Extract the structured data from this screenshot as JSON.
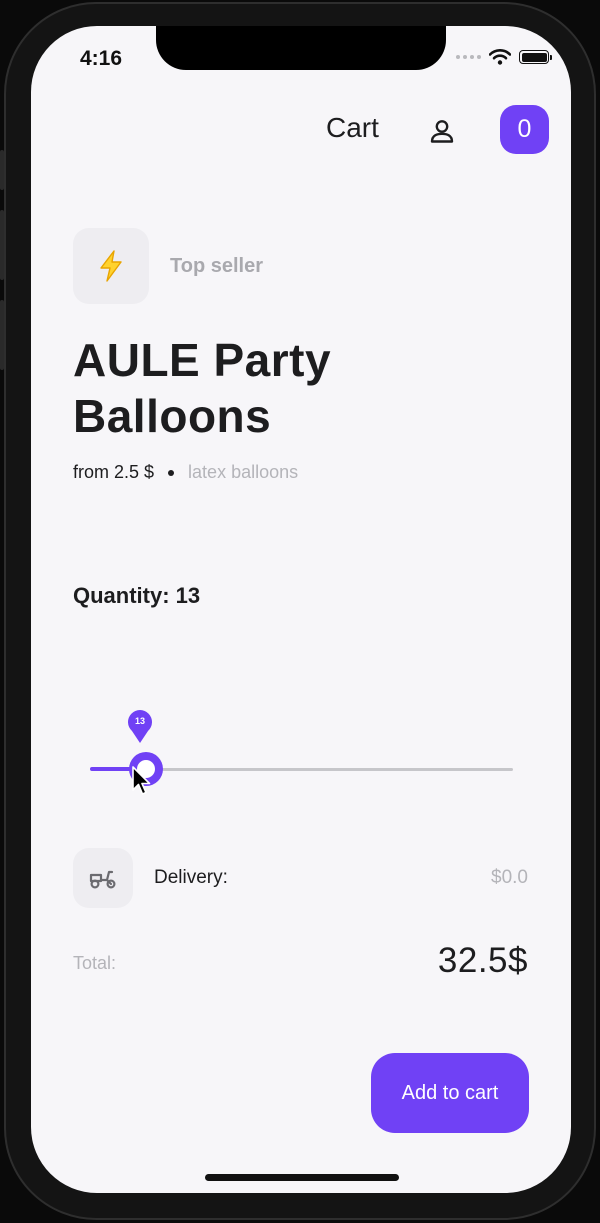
{
  "status_bar": {
    "time": "4:16"
  },
  "header": {
    "title": "Cart",
    "cart_count": "0"
  },
  "product": {
    "badge_label": "Top seller",
    "title": "AULE  Party\nBalloons",
    "price_from": "from 2.5 $",
    "category": "latex balloons"
  },
  "quantity": {
    "label": "Quantity: 13",
    "slider_value": "13",
    "slider_fraction": 0.13
  },
  "delivery": {
    "label": "Delivery:",
    "value": "$0.0"
  },
  "total": {
    "label": "Total:",
    "value": "32.5$"
  },
  "actions": {
    "add_to_cart_label": "Add to cart"
  },
  "colors": {
    "accent": "#7041f5",
    "background": "#f7f6f9",
    "tile": "#eeedf1",
    "muted_text": "#b4b4b9",
    "top_seller_icon": "#f5b800"
  },
  "icons": {
    "top_seller": "lightning-icon",
    "profile": "user-icon",
    "delivery": "scooter-icon",
    "wifi": "wifi-icon",
    "battery": "battery-icon",
    "cursor": "mouse-cursor-icon"
  }
}
